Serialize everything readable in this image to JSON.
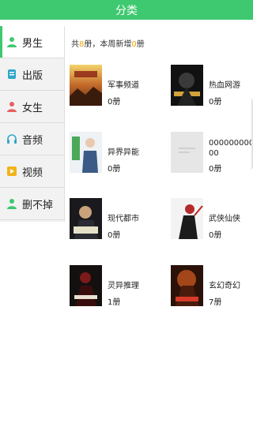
{
  "title": "分类",
  "sidebar": {
    "items": [
      {
        "label": "男生",
        "icon": "person-icon",
        "color": "#3ec86f",
        "active": true
      },
      {
        "label": "出版",
        "icon": "book-icon",
        "color": "#2fa7c9",
        "active": false
      },
      {
        "label": "女生",
        "icon": "person-icon",
        "color": "#e86060",
        "active": false
      },
      {
        "label": "音频",
        "icon": "headphones-icon",
        "color": "#2fa7c9",
        "active": false
      },
      {
        "label": "视频",
        "icon": "play-icon",
        "color": "#f2b318",
        "active": false
      },
      {
        "label": "删不掉",
        "icon": "person-icon",
        "color": "#3ec86f",
        "active": false
      }
    ]
  },
  "summary": {
    "prefix": "共",
    "total": "8",
    "middle": "册，本周新增",
    "new_count": "0",
    "suffix": "册"
  },
  "categories": [
    {
      "name": "军事频道",
      "count": "0册"
    },
    {
      "name": "热血网游",
      "count": "0册"
    },
    {
      "name": "异界异能",
      "count": "0册"
    },
    {
      "name": "0000000000000",
      "count": "0册"
    },
    {
      "name": "现代都市",
      "count": "0册"
    },
    {
      "name": "武侠仙侠",
      "count": "0册"
    },
    {
      "name": "灵异推理",
      "count": "1册"
    },
    {
      "name": "玄幻奇幻",
      "count": "7册"
    }
  ],
  "colors": {
    "accent": "#3ec86f",
    "highlight": "#f2a20a"
  }
}
